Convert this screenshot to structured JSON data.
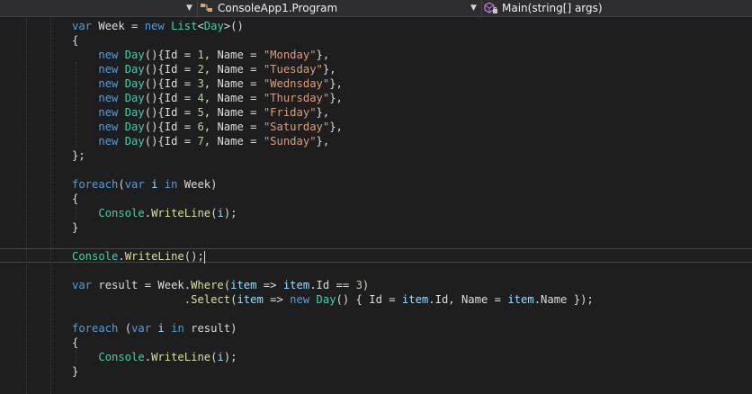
{
  "navbar": {
    "class_dropdown": "ConsoleApp1.Program",
    "member_dropdown": "Main(string[] args)"
  },
  "code": {
    "lines": [
      [
        {
          "t": "var",
          "c": "kw"
        },
        {
          "t": " Week = ",
          "c": "pl"
        },
        {
          "t": "new",
          "c": "kw"
        },
        {
          "t": " ",
          "c": "pl"
        },
        {
          "t": "List",
          "c": "ty"
        },
        {
          "t": "<",
          "c": "pl"
        },
        {
          "t": "Day",
          "c": "ty"
        },
        {
          "t": ">()",
          "c": "pl"
        }
      ],
      [
        {
          "t": "{",
          "c": "pl"
        }
      ],
      [
        {
          "t": "    ",
          "c": "pl"
        },
        {
          "t": "new",
          "c": "kw"
        },
        {
          "t": " ",
          "c": "pl"
        },
        {
          "t": "Day",
          "c": "ty"
        },
        {
          "t": "(){Id = ",
          "c": "pl"
        },
        {
          "t": "1",
          "c": "num"
        },
        {
          "t": ", Name = ",
          "c": "pl"
        },
        {
          "t": "\"Monday\"",
          "c": "str"
        },
        {
          "t": "},",
          "c": "pl"
        }
      ],
      [
        {
          "t": "    ",
          "c": "pl"
        },
        {
          "t": "new",
          "c": "kw"
        },
        {
          "t": " ",
          "c": "pl"
        },
        {
          "t": "Day",
          "c": "ty"
        },
        {
          "t": "(){Id = ",
          "c": "pl"
        },
        {
          "t": "2",
          "c": "num"
        },
        {
          "t": ", Name = ",
          "c": "pl"
        },
        {
          "t": "\"Tuesday\"",
          "c": "str"
        },
        {
          "t": "},",
          "c": "pl"
        }
      ],
      [
        {
          "t": "    ",
          "c": "pl"
        },
        {
          "t": "new",
          "c": "kw"
        },
        {
          "t": " ",
          "c": "pl"
        },
        {
          "t": "Day",
          "c": "ty"
        },
        {
          "t": "(){Id = ",
          "c": "pl"
        },
        {
          "t": "3",
          "c": "num"
        },
        {
          "t": ", Name = ",
          "c": "pl"
        },
        {
          "t": "\"Wednsday\"",
          "c": "str"
        },
        {
          "t": "},",
          "c": "pl"
        }
      ],
      [
        {
          "t": "    ",
          "c": "pl"
        },
        {
          "t": "new",
          "c": "kw"
        },
        {
          "t": " ",
          "c": "pl"
        },
        {
          "t": "Day",
          "c": "ty"
        },
        {
          "t": "(){Id = ",
          "c": "pl"
        },
        {
          "t": "4",
          "c": "num"
        },
        {
          "t": ", Name = ",
          "c": "pl"
        },
        {
          "t": "\"Thursday\"",
          "c": "str"
        },
        {
          "t": "},",
          "c": "pl"
        }
      ],
      [
        {
          "t": "    ",
          "c": "pl"
        },
        {
          "t": "new",
          "c": "kw"
        },
        {
          "t": " ",
          "c": "pl"
        },
        {
          "t": "Day",
          "c": "ty"
        },
        {
          "t": "(){Id = ",
          "c": "pl"
        },
        {
          "t": "5",
          "c": "num"
        },
        {
          "t": ", Name = ",
          "c": "pl"
        },
        {
          "t": "\"Friday\"",
          "c": "str"
        },
        {
          "t": "},",
          "c": "pl"
        }
      ],
      [
        {
          "t": "    ",
          "c": "pl"
        },
        {
          "t": "new",
          "c": "kw"
        },
        {
          "t": " ",
          "c": "pl"
        },
        {
          "t": "Day",
          "c": "ty"
        },
        {
          "t": "(){Id = ",
          "c": "pl"
        },
        {
          "t": "6",
          "c": "num"
        },
        {
          "t": ", Name = ",
          "c": "pl"
        },
        {
          "t": "\"Saturday\"",
          "c": "str"
        },
        {
          "t": "},",
          "c": "pl"
        }
      ],
      [
        {
          "t": "    ",
          "c": "pl"
        },
        {
          "t": "new",
          "c": "kw"
        },
        {
          "t": " ",
          "c": "pl"
        },
        {
          "t": "Day",
          "c": "ty"
        },
        {
          "t": "(){Id = ",
          "c": "pl"
        },
        {
          "t": "7",
          "c": "num"
        },
        {
          "t": ", Name = ",
          "c": "pl"
        },
        {
          "t": "\"Sunday\"",
          "c": "str"
        },
        {
          "t": "},",
          "c": "pl"
        }
      ],
      [
        {
          "t": "};",
          "c": "pl"
        }
      ],
      [],
      [
        {
          "t": "foreach",
          "c": "kw"
        },
        {
          "t": "(",
          "c": "pl"
        },
        {
          "t": "var",
          "c": "kw"
        },
        {
          "t": " ",
          "c": "pl"
        },
        {
          "t": "i",
          "c": "var"
        },
        {
          "t": " ",
          "c": "pl"
        },
        {
          "t": "in",
          "c": "kw"
        },
        {
          "t": " Week)",
          "c": "pl"
        }
      ],
      [
        {
          "t": "{",
          "c": "pl"
        }
      ],
      [
        {
          "t": "    ",
          "c": "pl"
        },
        {
          "t": "Console",
          "c": "ty"
        },
        {
          "t": ".",
          "c": "pl"
        },
        {
          "t": "WriteLine",
          "c": "mth"
        },
        {
          "t": "(",
          "c": "pl"
        },
        {
          "t": "i",
          "c": "var"
        },
        {
          "t": ");",
          "c": "pl"
        }
      ],
      [
        {
          "t": "}",
          "c": "pl"
        }
      ],
      [],
      [
        {
          "t": "Console",
          "c": "ty"
        },
        {
          "t": ".",
          "c": "pl"
        },
        {
          "t": "WriteLine",
          "c": "mth"
        },
        {
          "t": "();",
          "c": "pl"
        }
      ],
      [],
      [
        {
          "t": "var",
          "c": "kw"
        },
        {
          "t": " result = Week.",
          "c": "pl"
        },
        {
          "t": "Where",
          "c": "mth"
        },
        {
          "t": "(",
          "c": "pl"
        },
        {
          "t": "item",
          "c": "var"
        },
        {
          "t": " => ",
          "c": "pl"
        },
        {
          "t": "item",
          "c": "var"
        },
        {
          "t": ".Id == ",
          "c": "pl"
        },
        {
          "t": "3",
          "c": "num"
        },
        {
          "t": ")",
          "c": "pl"
        }
      ],
      [
        {
          "t": "                 .",
          "c": "pl"
        },
        {
          "t": "Select",
          "c": "mth"
        },
        {
          "t": "(",
          "c": "pl"
        },
        {
          "t": "item",
          "c": "var"
        },
        {
          "t": " => ",
          "c": "pl"
        },
        {
          "t": "new",
          "c": "kw"
        },
        {
          "t": " ",
          "c": "pl"
        },
        {
          "t": "Day",
          "c": "ty"
        },
        {
          "t": "() { Id = ",
          "c": "pl"
        },
        {
          "t": "item",
          "c": "var"
        },
        {
          "t": ".Id, Name = ",
          "c": "pl"
        },
        {
          "t": "item",
          "c": "var"
        },
        {
          "t": ".Name });",
          "c": "pl"
        }
      ],
      [],
      [
        {
          "t": "foreach",
          "c": "kw"
        },
        {
          "t": " (",
          "c": "pl"
        },
        {
          "t": "var",
          "c": "kw"
        },
        {
          "t": " ",
          "c": "pl"
        },
        {
          "t": "i",
          "c": "var"
        },
        {
          "t": " ",
          "c": "pl"
        },
        {
          "t": "in",
          "c": "kw"
        },
        {
          "t": " result)",
          "c": "pl"
        }
      ],
      [
        {
          "t": "{",
          "c": "pl"
        }
      ],
      [
        {
          "t": "    ",
          "c": "pl"
        },
        {
          "t": "Console",
          "c": "ty"
        },
        {
          "t": ".",
          "c": "pl"
        },
        {
          "t": "WriteLine",
          "c": "mth"
        },
        {
          "t": "(",
          "c": "pl"
        },
        {
          "t": "i",
          "c": "var"
        },
        {
          "t": ");",
          "c": "pl"
        }
      ],
      [
        {
          "t": "}",
          "c": "pl"
        }
      ]
    ]
  }
}
